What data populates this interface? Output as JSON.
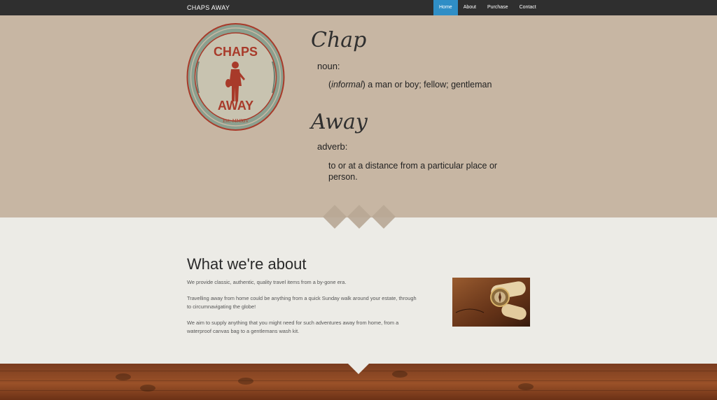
{
  "nav": {
    "brand": "CHAPS AWAY",
    "items": [
      {
        "label": "Home",
        "active": true
      },
      {
        "label": "About",
        "active": false
      },
      {
        "label": "Purchase",
        "active": false
      },
      {
        "label": "Contact",
        "active": false
      }
    ]
  },
  "logo": {
    "text_top": "CHAPS",
    "text_bottom": "AWAY",
    "est": "Est. MMXIV"
  },
  "definitions": {
    "word1": "Chap",
    "pos1": "noun:",
    "def1_part1": "(",
    "def1_italic": "informal",
    "def1_part2": ") a man or boy; fellow; gentleman",
    "word2": "Away",
    "pos2": "adverb:",
    "def2_line1": "to or at a distance from a particular place or",
    "def2_line2": "person."
  },
  "about": {
    "title": "What we're about",
    "p1": "We provide classic, authentic, quality travel items from a by-gone era.",
    "p2_line1": "Travelling away from home could be anything from a quick Sunday walk around your estate, through",
    "p2_line2": "to circumnavigating the globe!",
    "p3_line1": "We aim to supply anything that you might need for such adventures away from home, from a",
    "p3_line2": "waterproof canvas bag to a gentlemans wash kit."
  },
  "colors": {
    "nav_bg": "#2f2f2f",
    "nav_active": "#2f8ec6",
    "hero_bg": "#c7b6a3",
    "logo_red": "#a83a2a",
    "logo_green": "#7d9a86"
  }
}
